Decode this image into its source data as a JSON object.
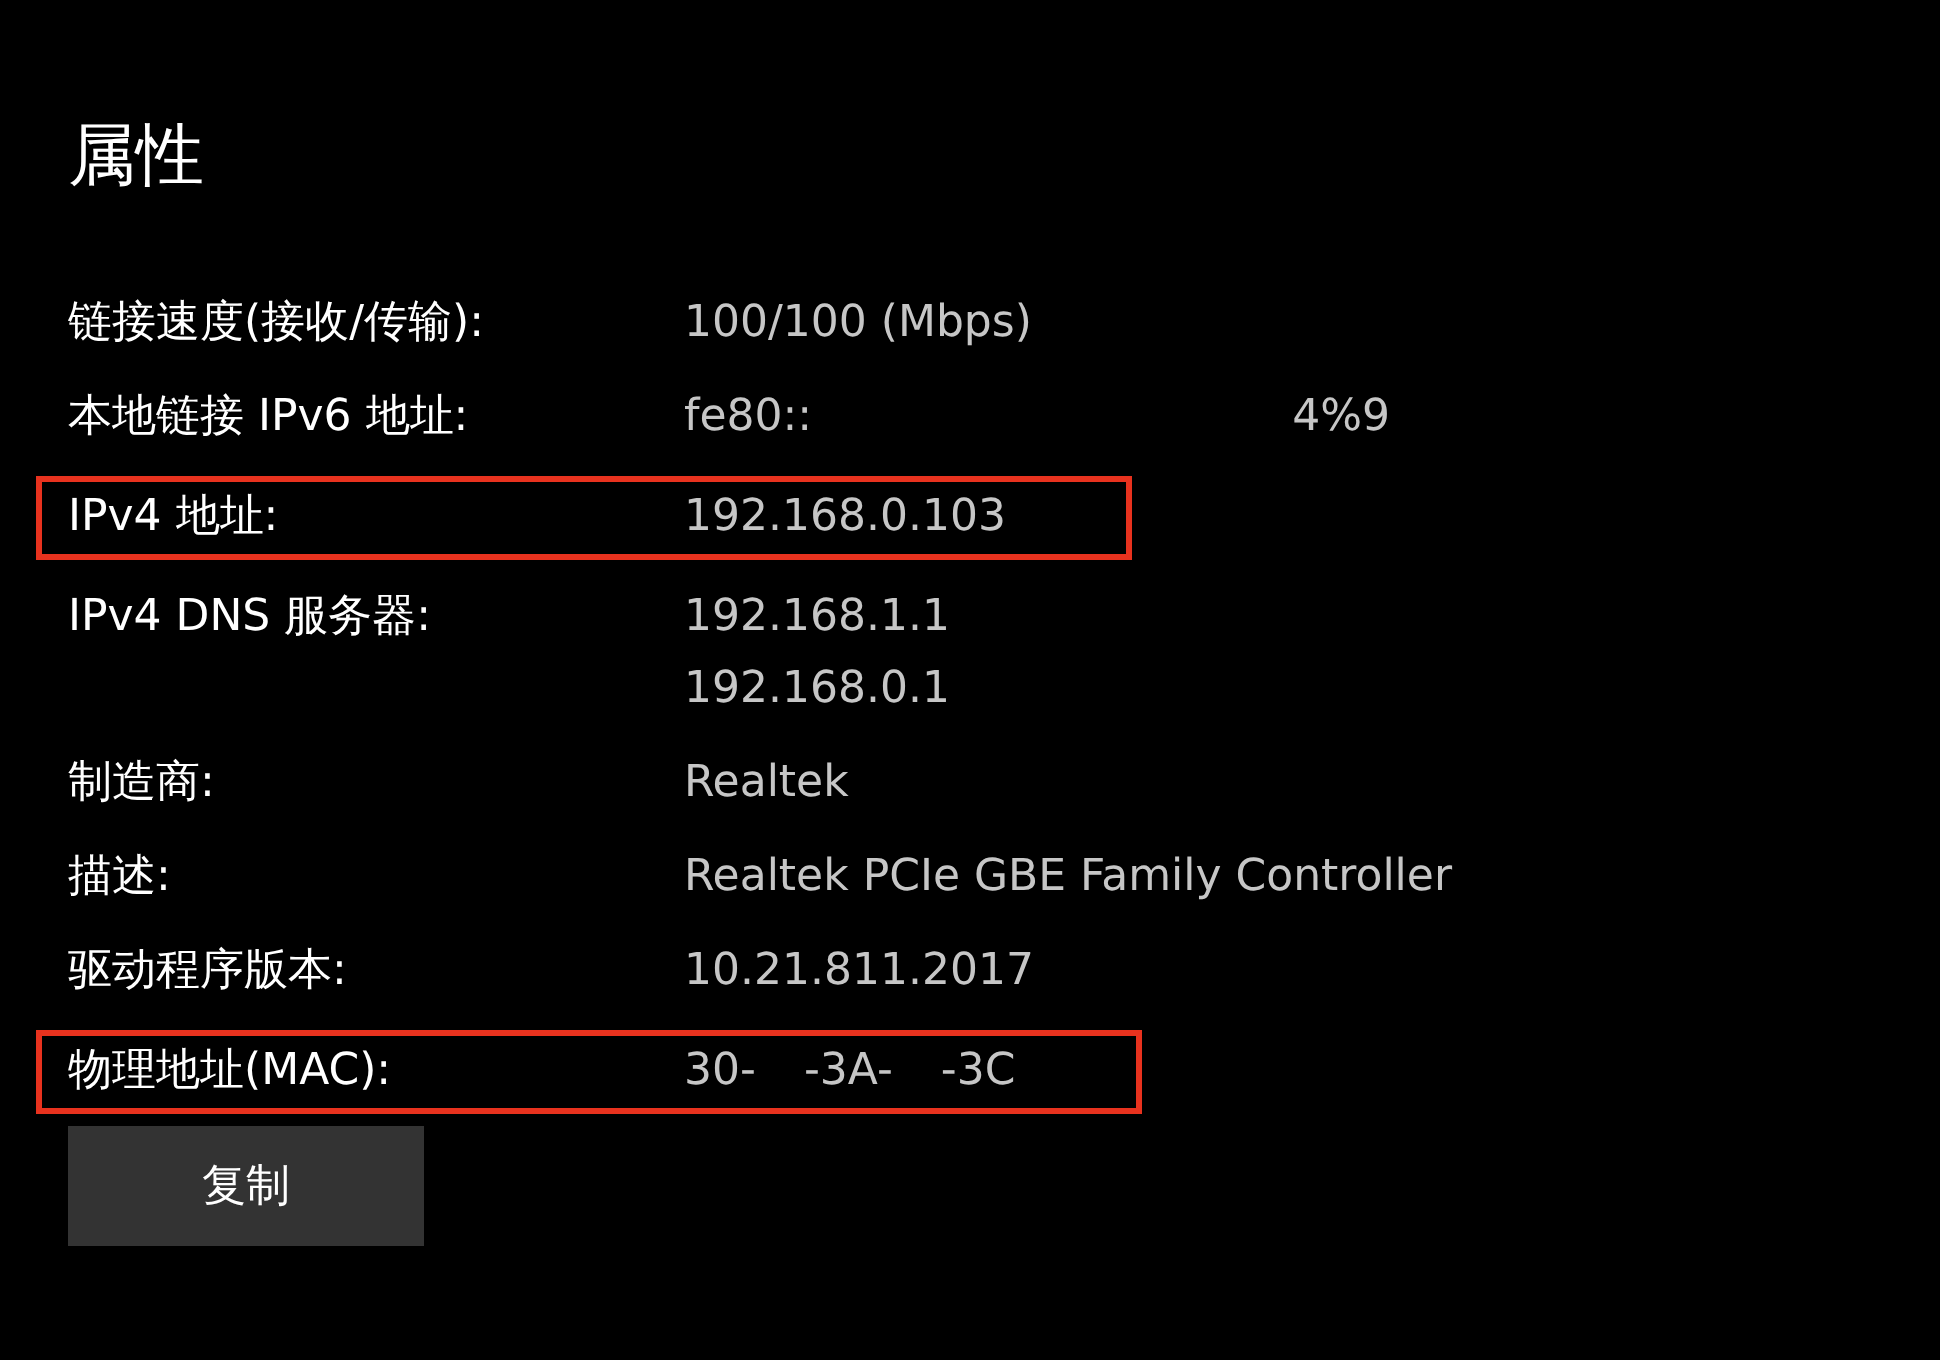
{
  "title": "属性",
  "rows": [
    {
      "label": "链接速度(接收/传输):",
      "values": [
        [
          "100/100 (Mbps)"
        ]
      ],
      "highlighted": false
    },
    {
      "label": "本地链接 IPv6 地址:",
      "values": [
        [
          "fe80::",
          "4%9"
        ]
      ],
      "highlighted": false
    },
    {
      "label": "IPv4 地址:",
      "values": [
        [
          "192.168.0.103"
        ]
      ],
      "highlighted": true
    },
    {
      "label": "IPv4 DNS 服务器:",
      "values": [
        [
          "192.168.1.1"
        ],
        [
          "192.168.0.1"
        ]
      ],
      "highlighted": false
    },
    {
      "label": "制造商:",
      "values": [
        [
          "Realtek"
        ]
      ],
      "highlighted": false
    },
    {
      "label": "描述:",
      "values": [
        [
          "Realtek PCIe GBE Family Controller"
        ]
      ],
      "highlighted": false
    },
    {
      "label": "驱动程序版本:",
      "values": [
        [
          "10.21.811.2017"
        ]
      ],
      "highlighted": false
    },
    {
      "label": "物理地址(MAC):",
      "values": [
        [
          "30-",
          "-3A-",
          "-3C"
        ]
      ],
      "highlighted": true
    }
  ],
  "button": "复制"
}
